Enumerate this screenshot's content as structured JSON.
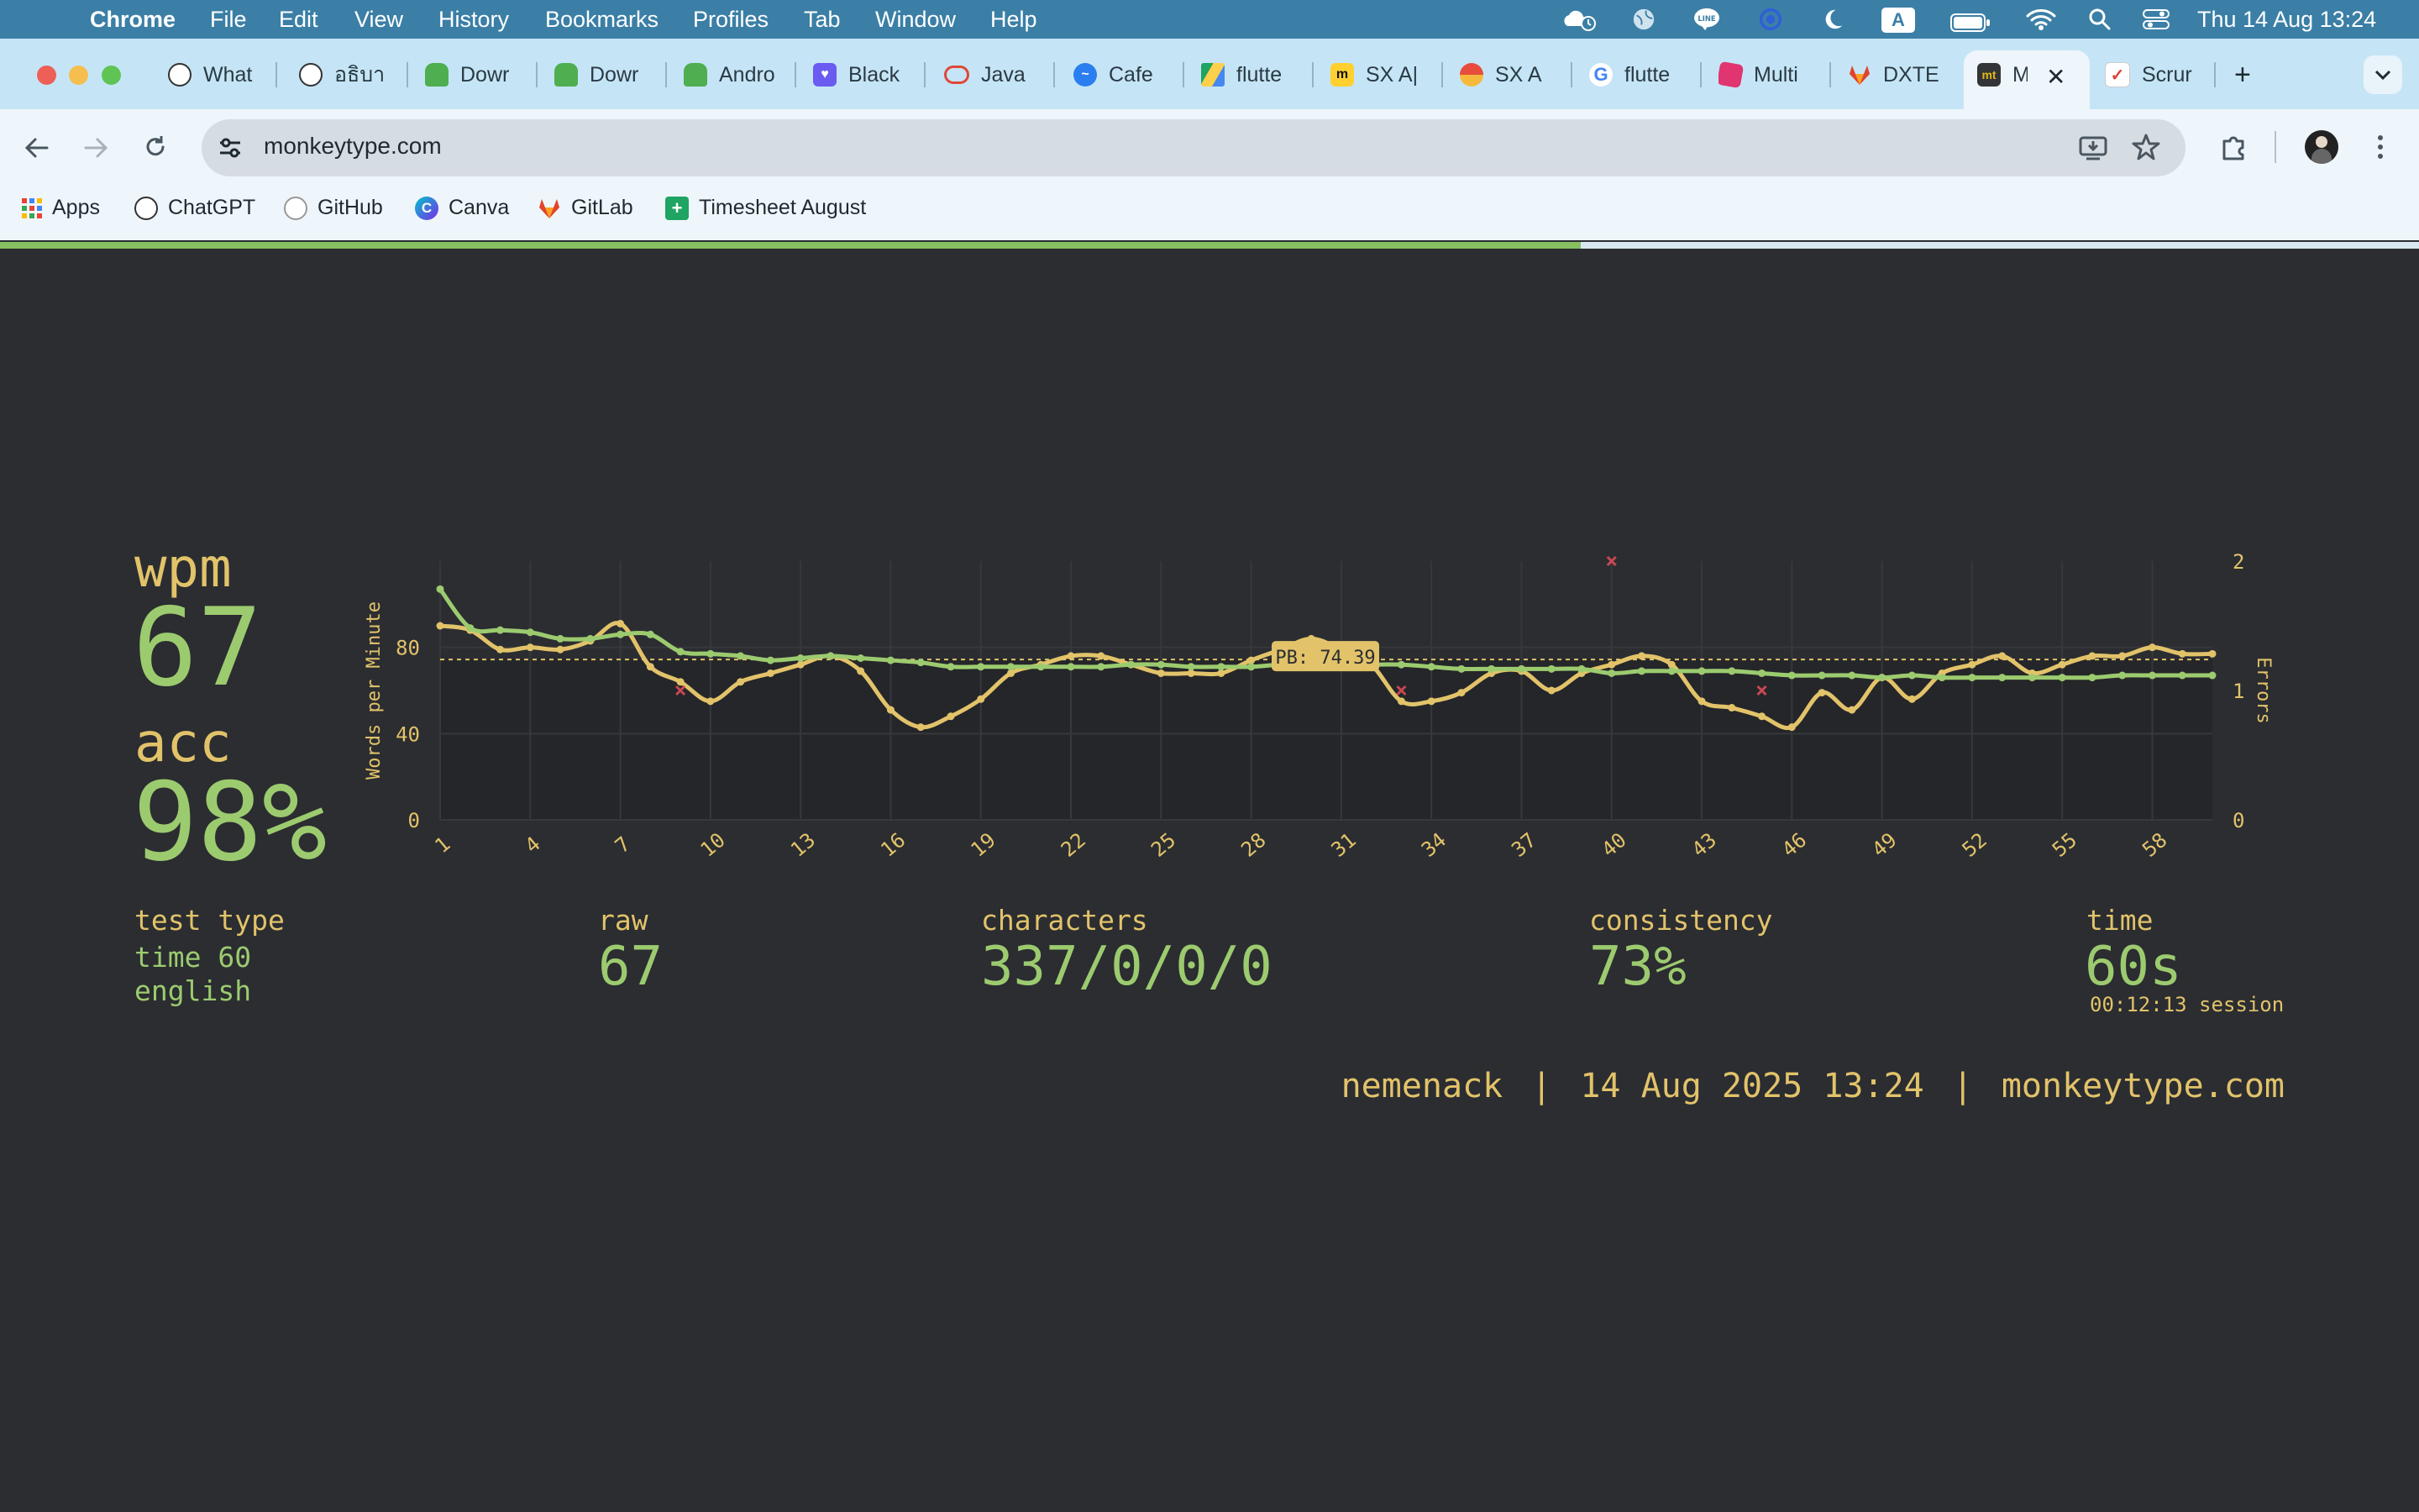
{
  "menubar": {
    "app": "Chrome",
    "items": [
      "File",
      "Edit",
      "View",
      "History",
      "Bookmarks",
      "Profiles",
      "Tab",
      "Window",
      "Help"
    ],
    "datetime": "Thu 14 Aug  13:24",
    "input_source": "A"
  },
  "tabs": [
    {
      "label": "What",
      "icon": "chatgpt-icon"
    },
    {
      "label": "อธิบา",
      "icon": "chatgpt-icon"
    },
    {
      "label": "Dowr",
      "icon": "android-icon"
    },
    {
      "label": "Dowr",
      "icon": "android-icon"
    },
    {
      "label": "Andro",
      "icon": "android-icon"
    },
    {
      "label": "Black",
      "icon": "heart-chat-icon"
    },
    {
      "label": "Java",
      "icon": "oracle-icon"
    },
    {
      "label": "Cafe",
      "icon": "messenger-icon"
    },
    {
      "label": "flutte",
      "icon": "google-drive-icon"
    },
    {
      "label": "SX A|",
      "icon": "miro-icon"
    },
    {
      "label": "SX A",
      "icon": "sx-icon"
    },
    {
      "label": "flutte",
      "icon": "google-icon"
    },
    {
      "label": "Multi",
      "icon": "cube-icon"
    },
    {
      "label": "DXTE",
      "icon": "gitlab-icon"
    },
    {
      "label": "M",
      "icon": "monkeytype-icon",
      "active": true
    },
    {
      "label": "Scrur",
      "icon": "todo-icon"
    }
  ],
  "monkeytype_badge": "mt",
  "toolbar": {
    "url": "monkeytype.com"
  },
  "bookmarks": [
    "Apps",
    "ChatGPT",
    "GitHub",
    "Canva",
    "GitLab",
    "Timesheet August"
  ],
  "load_progress": 0.65,
  "result": {
    "wpm_label": "wpm",
    "wpm": "67",
    "acc_label": "acc",
    "acc": "98%",
    "test_type_label": "test type",
    "test_type_lines": [
      "time 60",
      "english"
    ],
    "raw_label": "raw",
    "raw": "67",
    "characters_label": "characters",
    "characters": "337/0/0/0",
    "consistency_label": "consistency",
    "consistency": "73%",
    "time_label": "time",
    "time": "60s",
    "session": "00:12:13 session",
    "footer": {
      "user": "nemenack",
      "sep1": "|",
      "date": "14 Aug 2025 13:24",
      "sep2": "|",
      "site": "monkeytype.com"
    }
  },
  "colors": {
    "main": "#e2c36a",
    "sub": "#9ccb6f",
    "error": "#ca4754",
    "bg": "#2b2d31"
  },
  "chart_data": {
    "type": "line",
    "ylabel": "Words per Minute",
    "y2label": "Errors",
    "ylim": [
      0,
      120
    ],
    "y2lim": [
      0,
      2
    ],
    "yticks": [
      0,
      40,
      80
    ],
    "y2ticks": [
      0,
      1,
      2
    ],
    "xticks": [
      1,
      4,
      7,
      10,
      13,
      16,
      19,
      22,
      25,
      28,
      31,
      34,
      37,
      40,
      43,
      46,
      49,
      52,
      55,
      58
    ],
    "x": [
      1,
      2,
      3,
      4,
      5,
      6,
      7,
      8,
      9,
      10,
      11,
      12,
      13,
      14,
      15,
      16,
      17,
      18,
      19,
      20,
      21,
      22,
      23,
      24,
      25,
      26,
      27,
      28,
      29,
      30,
      31,
      32,
      33,
      34,
      35,
      36,
      37,
      38,
      39,
      40,
      41,
      42,
      43,
      44,
      45,
      46,
      47,
      48,
      49,
      50,
      51,
      52,
      53,
      54,
      55,
      56,
      57,
      58,
      59,
      60
    ],
    "series": [
      {
        "name": "wpm",
        "color": "#e2c36a",
        "values": [
          90,
          88,
          79,
          80,
          79,
          83,
          91,
          71,
          64,
          55,
          64,
          68,
          72,
          76,
          69,
          51,
          43,
          48,
          56,
          68,
          72,
          76,
          76,
          72,
          68,
          68,
          68,
          74,
          79,
          84,
          79,
          72,
          55,
          55,
          59,
          68,
          69,
          60,
          68,
          72,
          76,
          72,
          55,
          52,
          48,
          43,
          59,
          51,
          66,
          56,
          68,
          72,
          76,
          68,
          72,
          76,
          76,
          80,
          77,
          77
        ]
      },
      {
        "name": "raw",
        "color": "#9ccb6f",
        "values": [
          107,
          89,
          88,
          87,
          84,
          84,
          86,
          86,
          78,
          77,
          76,
          74,
          75,
          76,
          75,
          74,
          73,
          71,
          71,
          71,
          71,
          71,
          71,
          72,
          72,
          71,
          71,
          71,
          72,
          72,
          72,
          72,
          72,
          71,
          70,
          70,
          70,
          70,
          70,
          68,
          69,
          69,
          69,
          69,
          68,
          67,
          67,
          67,
          66,
          67,
          66,
          66,
          66,
          66,
          66,
          66,
          67,
          67,
          67,
          67
        ]
      },
      {
        "name": "errors",
        "color": "#ca4754",
        "points": [
          [
            9,
            1
          ],
          [
            33,
            1
          ],
          [
            40,
            2
          ],
          [
            45,
            1
          ]
        ]
      }
    ],
    "annotation": {
      "label": "PB: 74.39",
      "value": 74.39
    }
  }
}
